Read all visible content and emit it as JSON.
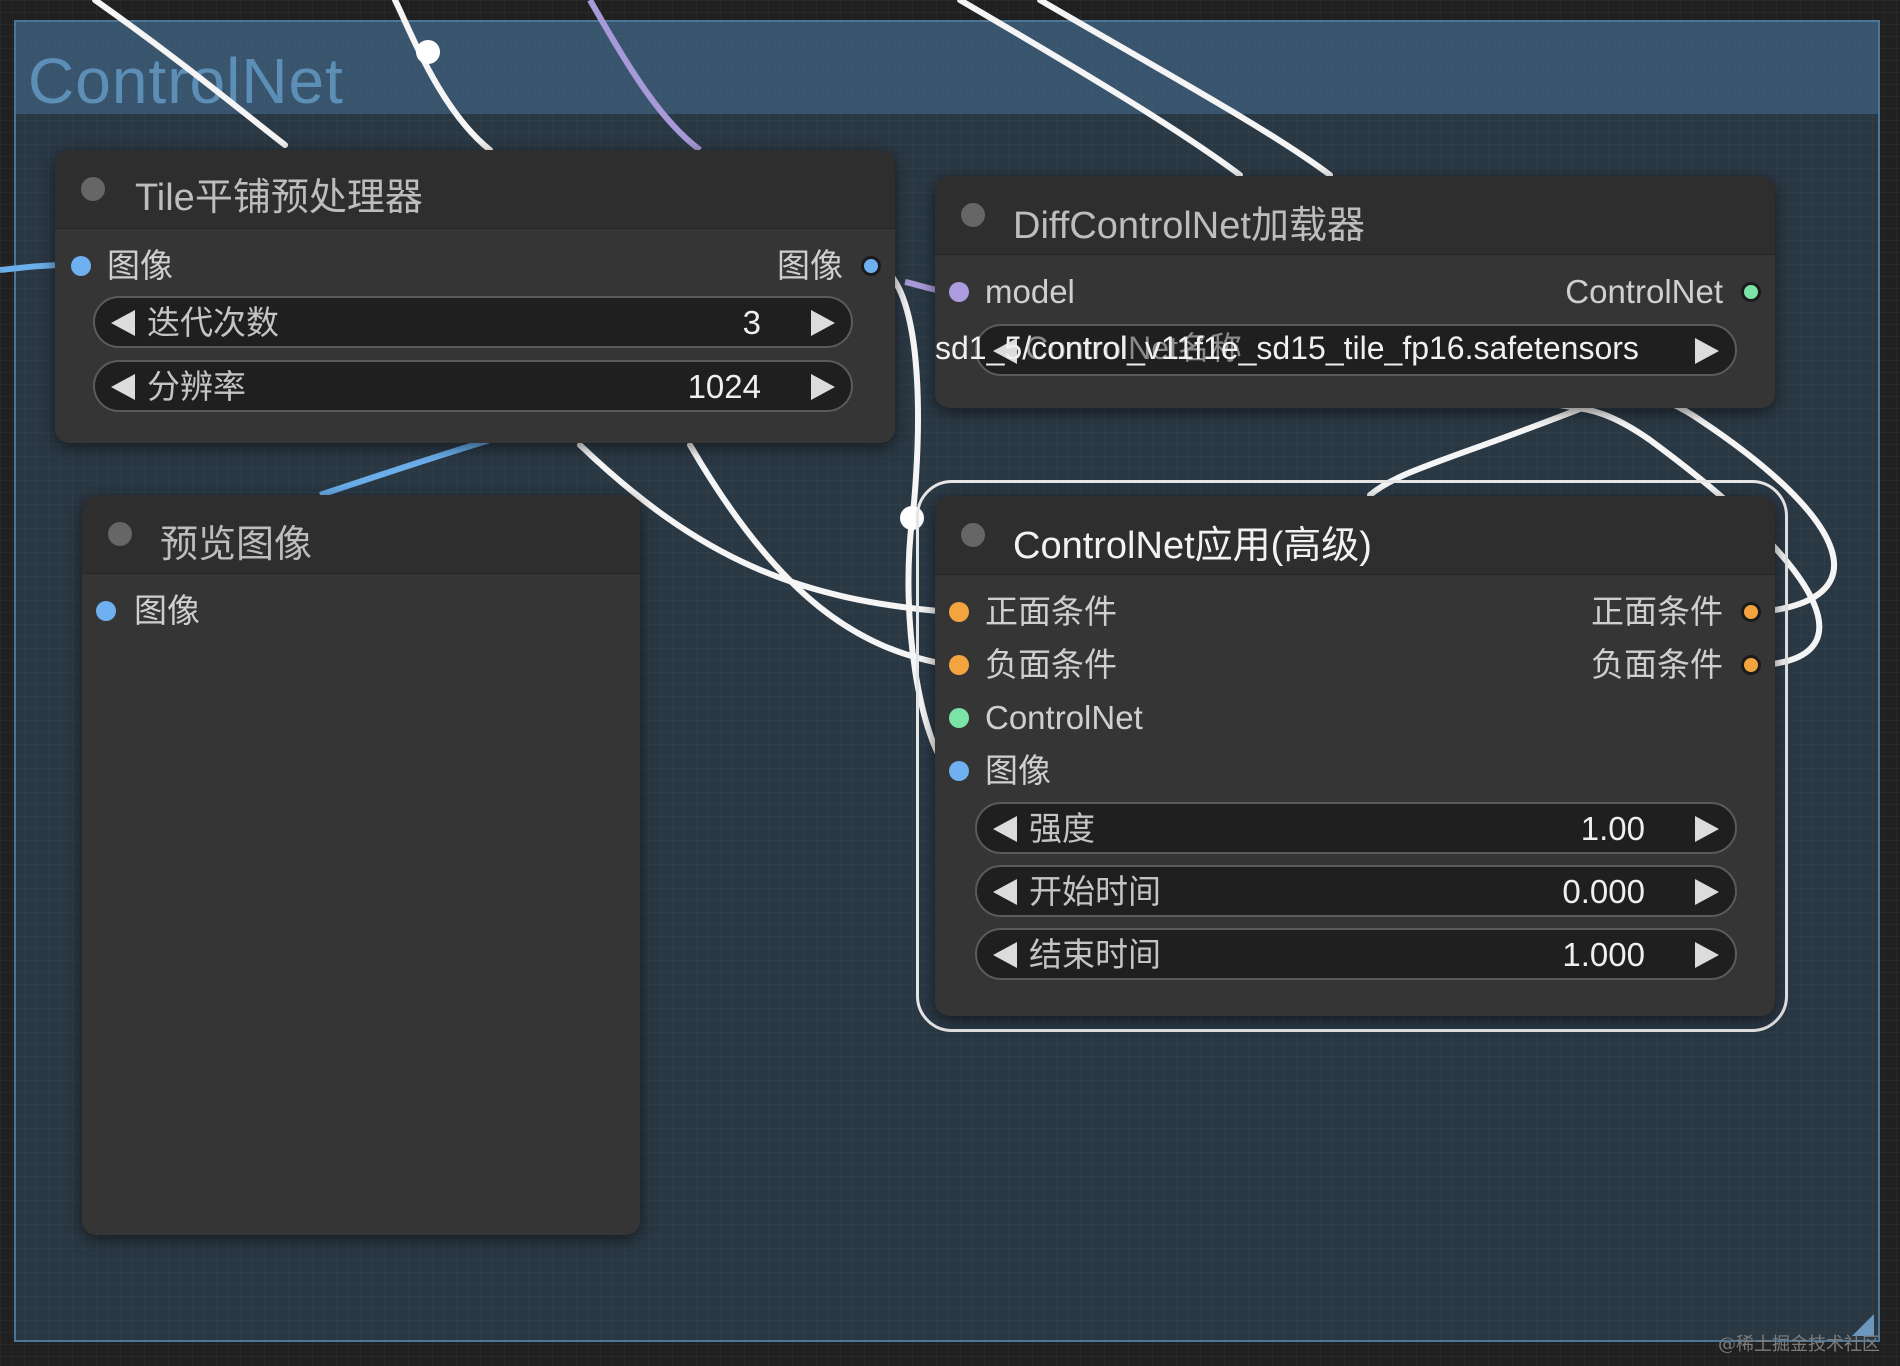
{
  "group": {
    "title": "ControlNet"
  },
  "tile_node": {
    "title": "Tile平铺预处理器",
    "input_label": "图像",
    "output_label": "图像",
    "widgets": [
      {
        "label": "迭代次数",
        "value": "3"
      },
      {
        "label": "分辨率",
        "value": "1024"
      }
    ]
  },
  "loader_node": {
    "title": "DiffControlNet加载器",
    "input_label": "model",
    "output_label": "ControlNet",
    "combo_value": "sd1_5/control_v11f1e_sd15_tile_fp16.safetensors",
    "combo_ghost": "ControlNet名称"
  },
  "preview_node": {
    "title": "预览图像",
    "input_label": "图像"
  },
  "apply_node": {
    "title": "ControlNet应用(高级)",
    "inputs": [
      "正面条件",
      "负面条件",
      "ControlNet",
      "图像"
    ],
    "outputs": [
      "正面条件",
      "负面条件"
    ],
    "widgets": [
      {
        "label": "强度",
        "value": "1.00"
      },
      {
        "label": "开始时间",
        "value": "0.000"
      },
      {
        "label": "结束时间",
        "value": "1.000"
      }
    ]
  },
  "colors": {
    "image_port": "#6fb0f0",
    "model_port": "#ad9ce0",
    "controlnet_port": "#7be3a8",
    "conditioning_port": "#f3a43f",
    "group_accent": "#5d8fb6"
  },
  "watermark": "@稀土掘金技术社区"
}
